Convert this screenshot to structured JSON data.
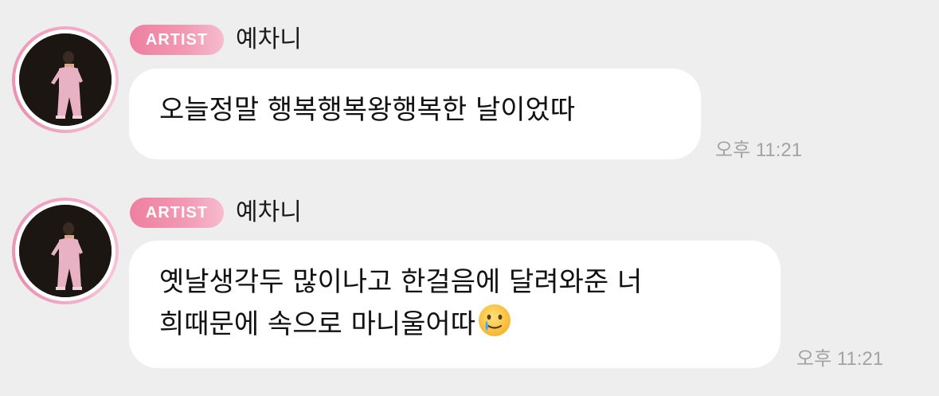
{
  "messages": [
    {
      "badge": "ARTIST",
      "name": "예차니",
      "text_lines": [
        "오늘정말 행복행복왕행복한 날이었따"
      ],
      "time": "오후 11:21"
    },
    {
      "badge": "ARTIST",
      "name": "예차니",
      "text_lines": [
        "옛날생각두 많이나고 한걸음에 달려와준 너",
        "희때문에 속으로 마니울어따"
      ],
      "emoji": "face-holding-back-tears-icon",
      "time": "오후 11:21"
    }
  ],
  "colors": {
    "background": "#eeeeee",
    "bubble": "#ffffff",
    "badge_start": "#ee7f9f",
    "badge_end": "#f6bccd",
    "time_text": "#a3a3a3"
  }
}
